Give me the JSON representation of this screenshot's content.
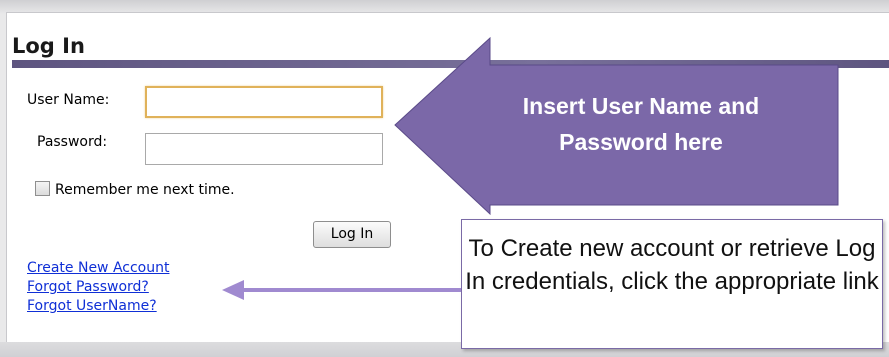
{
  "login": {
    "title": "Log In",
    "username_label": "User Name:",
    "username_value": "",
    "password_label": "Password:",
    "password_value": "",
    "remember_label": "Remember me next time.",
    "remember_checked": false,
    "submit_label": "Log In"
  },
  "links": [
    {
      "label": "Create New Account"
    },
    {
      "label": "Forgot Password?"
    },
    {
      "label": "Forgot UserName?"
    }
  ],
  "callouts": {
    "insert_line1": "Insert User Name and",
    "insert_line2": "Password here",
    "create_text": "To Create new account or retrieve Log In credentials, click the appropriate link"
  },
  "colors": {
    "accent_purple": "#7b68a8",
    "link_blue": "#0f2fd6",
    "focus_border": "#e0b25a"
  }
}
